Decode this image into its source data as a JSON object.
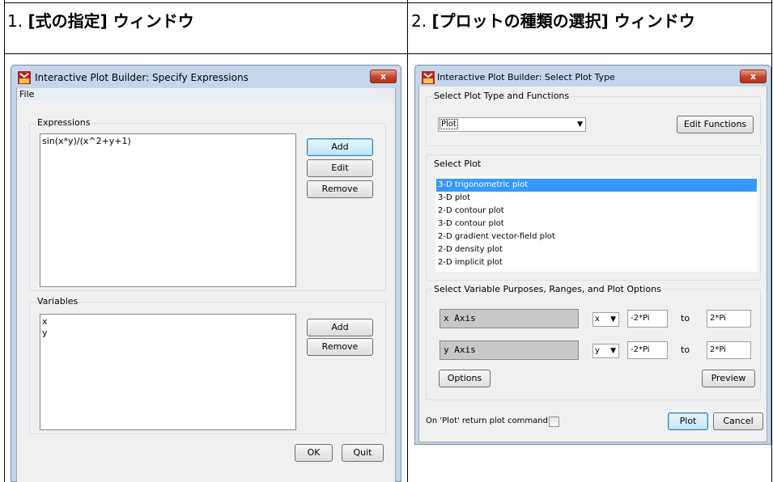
{
  "doc": {
    "col1_num": "1.",
    "col1_title": "[式の指定] ウィンドウ",
    "col2_num": "2.",
    "col2_title": "[プロットの種類の選択] ウィンドウ"
  },
  "win1": {
    "title": "Interactive Plot Builder: Specify Expressions",
    "close_label": "x",
    "menu_file": "File",
    "expressions_group": "Expressions",
    "expressions": [
      "sin(x*y)/(x^2+y+1)"
    ],
    "expr_add": "Add",
    "expr_edit": "Edit",
    "expr_remove": "Remove",
    "variables_group": "Variables",
    "variables": [
      "x",
      "y"
    ],
    "var_add": "Add",
    "var_remove": "Remove",
    "ok": "OK",
    "quit": "Quit"
  },
  "win2": {
    "title": "Interactive Plot Builder: Select Plot Type",
    "close_label": "x",
    "type_group": "Select Plot Type and Functions",
    "type_combo": "Plot",
    "edit_functions": "Edit Functions",
    "plot_group": "Select Plot",
    "plots": [
      "3-D trigonometric plot",
      "3-D plot",
      "2-D contour plot",
      "3-D contour plot",
      "2-D gradient vector-field plot",
      "2-D density plot",
      "2-D implicit plot"
    ],
    "selected_plot": "3-D trigonometric plot",
    "vars_group": "Select Variable Purposes, Ranges, and Plot Options",
    "x_label": "x Axis",
    "x_var": "x",
    "x_from": "-2*Pi",
    "x_to_word": "to",
    "x_to": "2*Pi",
    "y_label": "y Axis",
    "y_var": "y",
    "y_from": "-2*Pi",
    "y_to_word": "to",
    "y_to": "2*Pi",
    "options": "Options",
    "preview": "Preview",
    "return_cmd": "On 'Plot' return plot command",
    "return_checked": false,
    "plot": "Plot",
    "cancel": "Cancel"
  },
  "colors": {
    "titlebar": "#c5d6ea",
    "selection": "#3399ff",
    "close": "#c7402b"
  }
}
